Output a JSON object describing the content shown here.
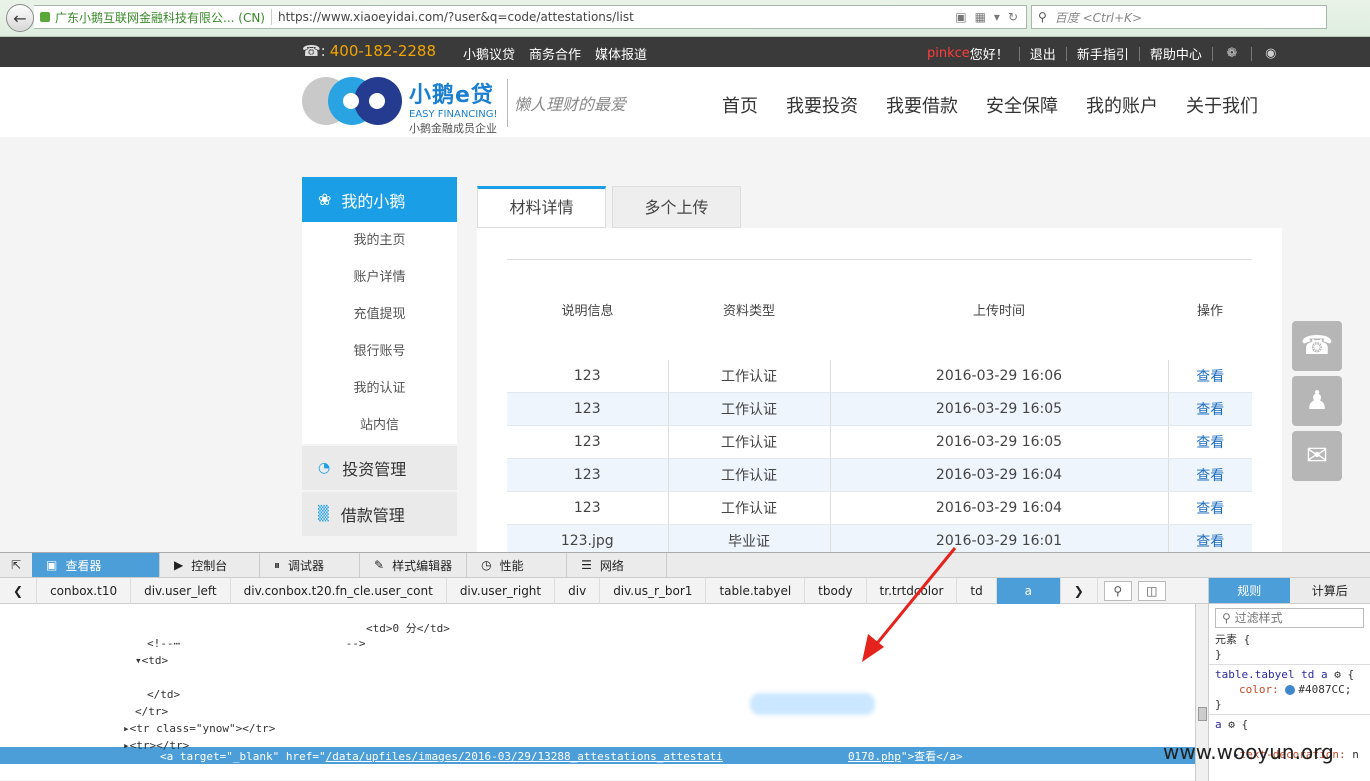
{
  "browser": {
    "site_identity": "广东小鹅互联网金融科技有限公... (CN)",
    "url": "https://www.xiaoeyidai.com/?user&q=code/attestations/list",
    "search_placeholder": "百度 <Ctrl+K>"
  },
  "topbar": {
    "phone": "400-182-2288",
    "links": [
      "小鹅议贷",
      "商务合作",
      "媒体报道"
    ],
    "username": "pinkce",
    "greeting": "您好！",
    "logout": "退出",
    "newbie_guide": "新手指引",
    "help_center": "帮助中心"
  },
  "header": {
    "logo_cn": "小鹅e贷",
    "logo_en": "EASY FINANCING!",
    "logo_sub": "小鹅金融成员企业",
    "slogan": "懒人理财的最爱",
    "nav": [
      "首页",
      "我要投资",
      "我要借款",
      "安全保障",
      "我的账户",
      "关于我们"
    ]
  },
  "sidebar": {
    "title": "我的小鹅",
    "items": [
      "我的主页",
      "账户详情",
      "充值提现",
      "银行账号",
      "我的认证",
      "站内信"
    ],
    "groups": [
      "投资管理",
      "借款管理"
    ]
  },
  "tabs": [
    "材料详情",
    "多个上传"
  ],
  "table": {
    "headers": [
      "说明信息",
      "资料类型",
      "上传时间",
      "操作"
    ],
    "rows": [
      [
        "123",
        "工作认证",
        "2016-03-29 16:06",
        "查看"
      ],
      [
        "123",
        "工作认证",
        "2016-03-29 16:05",
        "查看"
      ],
      [
        "123",
        "工作认证",
        "2016-03-29 16:05",
        "查看"
      ],
      [
        "123",
        "工作认证",
        "2016-03-29 16:04",
        "查看"
      ],
      [
        "123",
        "工作认证",
        "2016-03-29 16:04",
        "查看"
      ],
      [
        "123.jpg",
        "毕业证",
        "2016-03-29 16:01",
        "查看"
      ]
    ]
  },
  "devtools": {
    "tabs": [
      "查看器",
      "控制台",
      "调试器",
      "样式编辑器",
      "性能",
      "网络"
    ],
    "breadcrumbs": [
      "conbox.t10",
      "div.user_left",
      "div.conbox.t20.fn_cle.user_cont",
      "div.user_right",
      "div",
      "div.us_r_bor1",
      "table.tabyel",
      "tbody",
      "tr.trtdcolor",
      "td",
      "a"
    ],
    "markup_lines": {
      "td_text": "<td>0 分</td>",
      "comment": "<!--⋯                         -->",
      "td_open": "<td>",
      "a_prefix": "<a target=\"_blank\" href=\"",
      "a_href_start": "/data/upfiles/images/2016-03/29/13288_attestations_attestati",
      "a_href_end": "0170.php",
      "a_suffix": "\">查看</a>",
      "td_close": "</td>",
      "tr_close": "</tr>",
      "tr_ynow": "<tr class=\"ynow\"></tr>",
      "tr_empty": "<tr></tr>"
    },
    "side_tabs": [
      "规则",
      "计算后"
    ],
    "filter_placeholder": "过滤样式",
    "rules": {
      "element": "元素 {",
      "close": "}",
      "selector1": "table.tabyel td a",
      "prop_color": "color:",
      "color_value": "#4087CC;",
      "selector2": "a",
      "prop_decoration": "text-decoration:",
      "decoration_value": "n"
    }
  },
  "watermark": "www.wooyun.org",
  "colors": {
    "accent": "#1a9fe6",
    "link": "#1f6fc0",
    "rule_color": "#4087CC",
    "devtools_select": "#4c9ed9"
  }
}
